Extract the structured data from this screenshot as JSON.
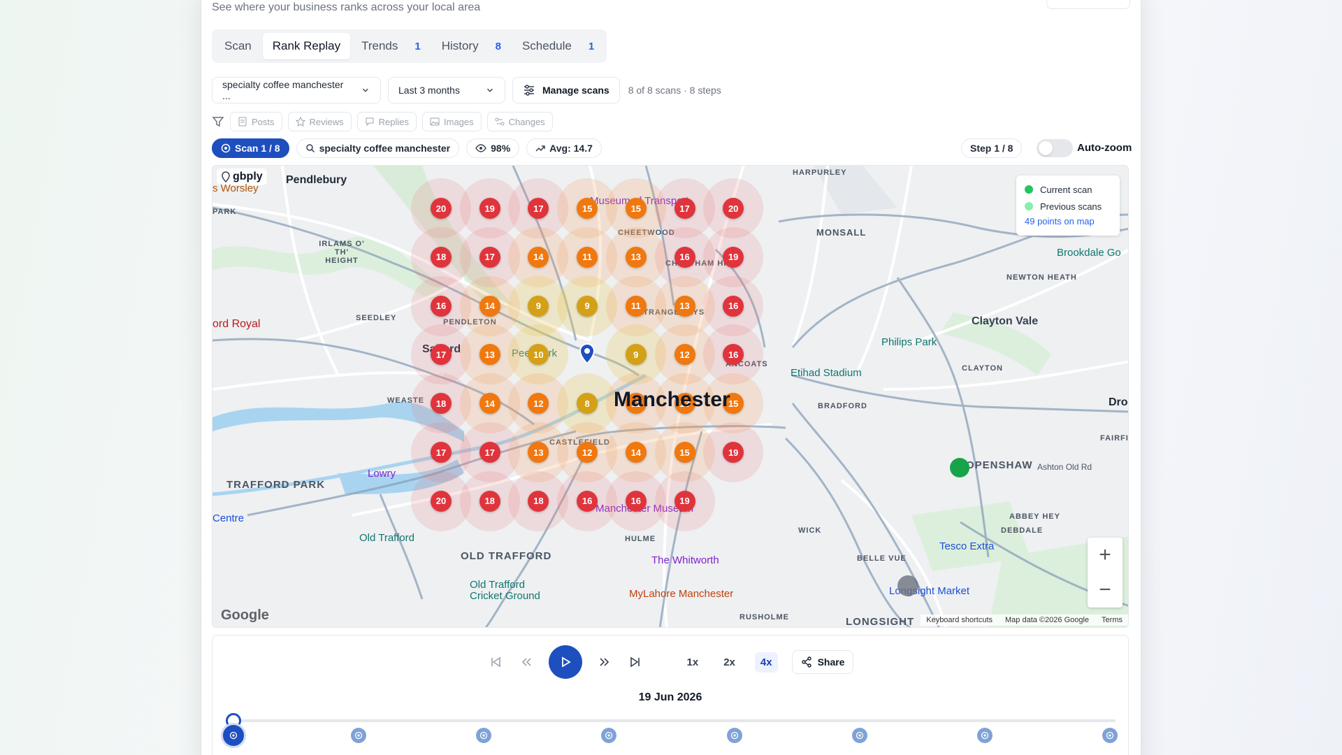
{
  "page": {
    "subtitle": "See where your business ranks across your local area"
  },
  "tabs": [
    {
      "label": "Scan",
      "count": ""
    },
    {
      "label": "Rank Replay",
      "count": ""
    },
    {
      "label": "Trends",
      "count": "1"
    },
    {
      "label": "History",
      "count": "8"
    },
    {
      "label": "Schedule",
      "count": "1"
    }
  ],
  "controls": {
    "keyword_select": "specialty coffee manchester ...",
    "range_select": "Last 3 months",
    "manage_label": "Manage scans",
    "scans_meta": "8 of 8 scans · 8 steps"
  },
  "filters": [
    "Posts",
    "Reviews",
    "Replies",
    "Images",
    "Changes"
  ],
  "status": {
    "scan_pill": "Scan 1 / 8",
    "keyword": "specialty coffee manchester",
    "visibility": "98%",
    "avg": "Avg: 14.7",
    "step": "Step 1 / 8",
    "autozoom": "Auto-zoom"
  },
  "map": {
    "logo": "gbply",
    "legend": {
      "current": "Current scan",
      "previous": "Previous scans",
      "points": "49 points on map"
    },
    "center_label": "Manchester",
    "labels": {
      "pendlebury": "Pendlebury",
      "worsley": "s Worsley",
      "park": "PARK",
      "irlams": "IRLAMS O' TH' HEIGHT",
      "salford": "Salford",
      "peel_park": "Peel Park",
      "royal": "ord Royal",
      "seedley": "SEEDLEY",
      "pendleton": "PENDLETON",
      "weaste": "WEASTE",
      "trafford_park": "TRAFFORD PARK",
      "lowry": "Lowry",
      "centre": "Centre",
      "old_trafford_stadium": "Old Trafford",
      "old_trafford": "OLD TRAFFORD",
      "cricket": "Old Trafford Cricket Ground",
      "hulme": "HULME",
      "whitworth": "The Whitworth",
      "mylahore": "MyLahore Manchester",
      "rusholme": "RUSHOLME",
      "longsight": "LONGSIGHT",
      "longsight_market": "Longsight Market",
      "belle_vue": "BELLE VUE",
      "tesco": "Tesco Extra",
      "openshaw": "OPENSHAW",
      "etihad": "Etihad Stadium",
      "philips_park": "Philips Park",
      "clayton_vale": "Clayton Vale",
      "clayton": "CLAYTON",
      "newton_heath": "NEWTON HEATH",
      "monsall": "MONSALL",
      "harpurley": "HARPURLEY",
      "brookdale": "Brookdale Go",
      "museum_transport": "Museum of Transport",
      "cheetwood": "CHEETWOOD",
      "cheetham_hill": "CHEETHAM HILL",
      "strangeways": "STRANGEWAYS",
      "ancoats": "ANCOATS",
      "castlefield": "CASTLEFIELD",
      "manchester_museum": "Manchester Museum",
      "abbey_hey": "ABBEY HEY",
      "debdale": "DEBDALE",
      "fairfield": "FAIRFI",
      "dro": "Dro",
      "ashton_old_rd": "Ashton Old Rd",
      "ardwick": "WICK",
      "bradford": "BRADFORD"
    },
    "google": "Google",
    "attribution": [
      "Keyboard shortcuts",
      "Map data ©2026 Google",
      "Terms"
    ],
    "zoom_in": "+",
    "zoom_out": "−"
  },
  "grid_ranks": [
    [
      20,
      19,
      17,
      15,
      15,
      17,
      20
    ],
    [
      18,
      17,
      14,
      11,
      13,
      16,
      19
    ],
    [
      16,
      14,
      9,
      9,
      11,
      13,
      16
    ],
    [
      17,
      13,
      10,
      null,
      9,
      12,
      16
    ],
    [
      18,
      14,
      12,
      8,
      11,
      13,
      15
    ],
    [
      17,
      17,
      13,
      12,
      14,
      15,
      19
    ],
    [
      20,
      18,
      18,
      16,
      16,
      19,
      null
    ]
  ],
  "rank_colors": {
    "top": "#d4a017",
    "mid": "#f0780f",
    "low": "#e0343d",
    "center": "#1e4fbf"
  },
  "player": {
    "date": "19 Jun 2026",
    "speeds": [
      "1x",
      "2x",
      "4x"
    ],
    "active_speed": "4x",
    "share": "Share",
    "steps": 8,
    "current_step": 1
  }
}
